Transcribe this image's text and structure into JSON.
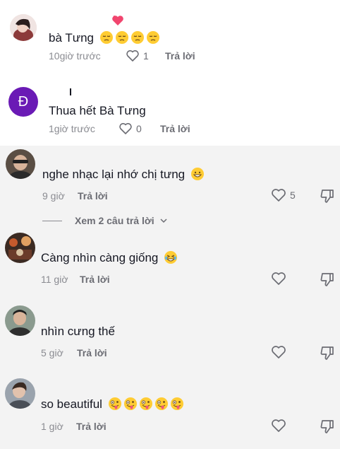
{
  "comments": [
    {
      "author_fragment": "",
      "text": "bà Tưng",
      "time": "10giờ trước",
      "likes": "1",
      "reply_label": "Trả lời",
      "emoji": "pensive",
      "emoji_count": 4
    },
    {
      "author_fragment": "",
      "avatar_letter": "Đ",
      "text": "Thua hết Bà Tưng",
      "time": "1giờ trước",
      "likes": "0",
      "reply_label": "Trả lời"
    },
    {
      "text": "nghe nhạc lại nhớ chị tưng",
      "time": "9 giờ",
      "likes": "5",
      "reply_label": "Trả lời",
      "emoji": "grin",
      "emoji_count": 1
    },
    {
      "text": "Càng nhìn càng giống",
      "time": "11 giờ",
      "likes": "",
      "reply_label": "Trả lời",
      "emoji": "laughing",
      "emoji_count": 1
    },
    {
      "text": "nhìn cưng thế",
      "time": "5 giờ",
      "likes": "",
      "reply_label": "Trả lời"
    },
    {
      "text": "so beautiful",
      "time": "1 giờ",
      "likes": "",
      "reply_label": "Trả lời",
      "emoji": "zany",
      "emoji_count": 5
    }
  ],
  "view_replies": "Xem 2 câu trả lời",
  "colors": {
    "accent_purple": "#6a1ab5",
    "heart_pink": "#f1456e",
    "emoji_yellow": "#ffcc33"
  }
}
